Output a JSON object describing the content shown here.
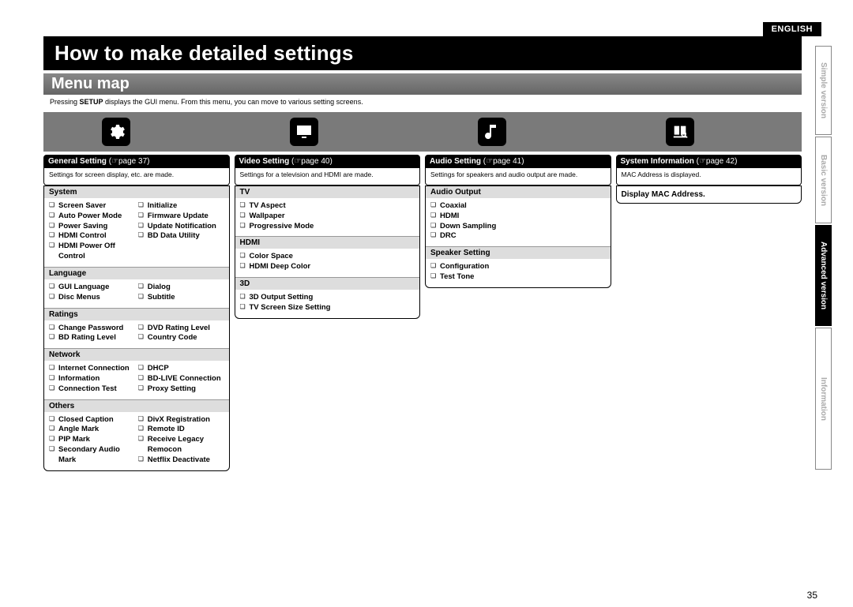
{
  "lang_tag": "ENGLISH",
  "side_tabs": {
    "simple": "Simple version",
    "basic": "Basic version",
    "advanced": "Advanced version",
    "information": "Information"
  },
  "main_title": "How to make detailed settings",
  "sub_title": "Menu map",
  "intro_pre": "Pressing ",
  "intro_bold": "SETUP",
  "intro_post": " displays the GUI menu. From this menu, you can move to various setting screens.",
  "page_num": "35",
  "page_ref_icon": "☞",
  "cols": {
    "general": {
      "title": "General Setting",
      "ref": "(☞page 37)",
      "desc": "Settings for screen display, etc. are made.",
      "sections": [
        {
          "title": "System",
          "left": [
            "Screen Saver",
            "Auto Power Mode",
            "Power Saving",
            "HDMI Control",
            "HDMI Power Off Control"
          ],
          "right": [
            "Initialize",
            "Firmware Update",
            "Update Notification",
            "BD Data Utility"
          ]
        },
        {
          "title": "Language",
          "left": [
            "GUI Language",
            "Disc Menus"
          ],
          "right": [
            "Dialog",
            "Subtitle"
          ]
        },
        {
          "title": "Ratings",
          "left": [
            "Change Password",
            "BD Rating Level"
          ],
          "right": [
            "DVD Rating Level",
            "Country Code"
          ]
        },
        {
          "title": "Network",
          "left": [
            "Internet Connection",
            "Information",
            "Connection Test"
          ],
          "right": [
            "DHCP",
            "BD-LIVE Connection",
            "Proxy Setting"
          ]
        },
        {
          "title": "Others",
          "left": [
            "Closed Caption",
            "Angle Mark",
            "PIP Mark",
            "Secondary Audio Mark"
          ],
          "right": [
            "DivX Registration",
            "Remote ID",
            "Receive Legacy Remocon",
            "Netflix Deactivate"
          ]
        }
      ]
    },
    "video": {
      "title": "Video Setting",
      "ref": "(☞page 40)",
      "desc": "Settings for a television and HDMI are made.",
      "sections": [
        {
          "title": "TV",
          "items": [
            "TV Aspect",
            "Wallpaper",
            "Progressive Mode"
          ]
        },
        {
          "title": "HDMI",
          "items": [
            "Color Space",
            "HDMI Deep Color"
          ]
        },
        {
          "title": "3D",
          "items": [
            "3D Output Setting",
            "TV Screen Size Setting"
          ]
        }
      ]
    },
    "audio": {
      "title": "Audio Setting",
      "ref": "(☞page 41)",
      "desc": "Settings for speakers and audio output are made.",
      "sections": [
        {
          "title": "Audio Output",
          "items": [
            "Coaxial",
            "HDMI",
            "Down Sampling",
            "DRC"
          ]
        },
        {
          "title": "Speaker Setting",
          "items": [
            "Configuration",
            "Test Tone"
          ]
        }
      ]
    },
    "sysinfo": {
      "title": "System Information",
      "ref": "(☞page 42)",
      "desc": "MAC Address is displayed.",
      "line": "Display MAC Address."
    }
  }
}
